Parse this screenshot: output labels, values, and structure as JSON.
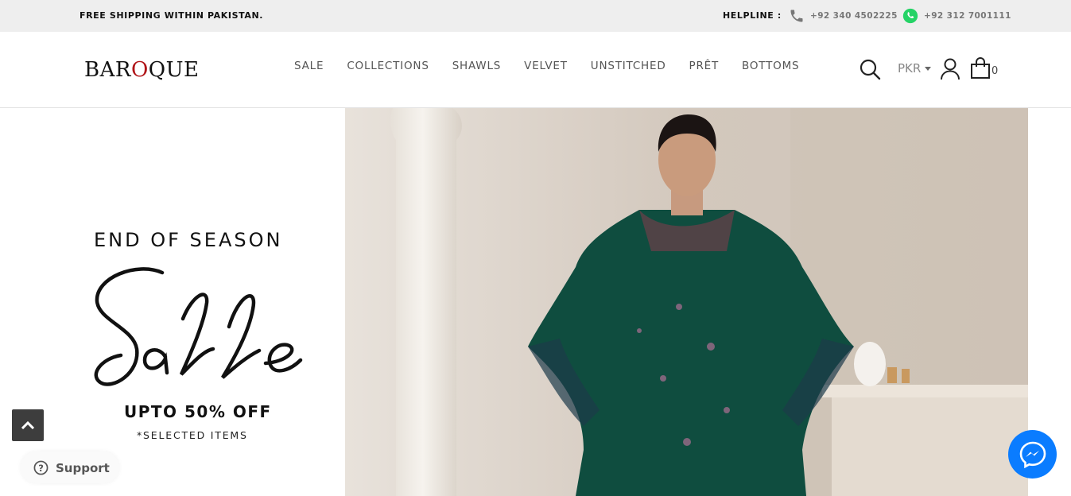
{
  "topbar": {
    "shipping_text": "FREE SHIPPING WITHIN PAKISTAN.",
    "helpline_label": "HELPLINE :",
    "phone_number": "+92 340 4502225",
    "whatsapp_number": "+92 312 7001111"
  },
  "header": {
    "logo_text": "BAROQUE",
    "nav": [
      "SALE",
      "COLLECTIONS",
      "SHAWLS",
      "VELVET",
      "UNSTITCHED",
      "PRÊT",
      "BOTTOMS"
    ],
    "currency": "PKR",
    "cart_count": "0"
  },
  "promo": {
    "headline": "END OF SEASON",
    "script_word": "Sale",
    "offer": "UPTO 50% OFF",
    "note": "*SELECTED ITEMS"
  },
  "widgets": {
    "support_label": "Support"
  },
  "colors": {
    "topbar_bg": "#eeeeee",
    "logo_accent": "#b01418",
    "messenger_blue": "#0a7cff",
    "whatsapp_green": "#25d366",
    "dress_green": "#0f4d3f"
  },
  "icons": [
    "phone-icon",
    "whatsapp-icon",
    "search-icon",
    "user-icon",
    "shopping-bag-icon",
    "chevron-up-icon",
    "question-icon",
    "messenger-icon"
  ]
}
